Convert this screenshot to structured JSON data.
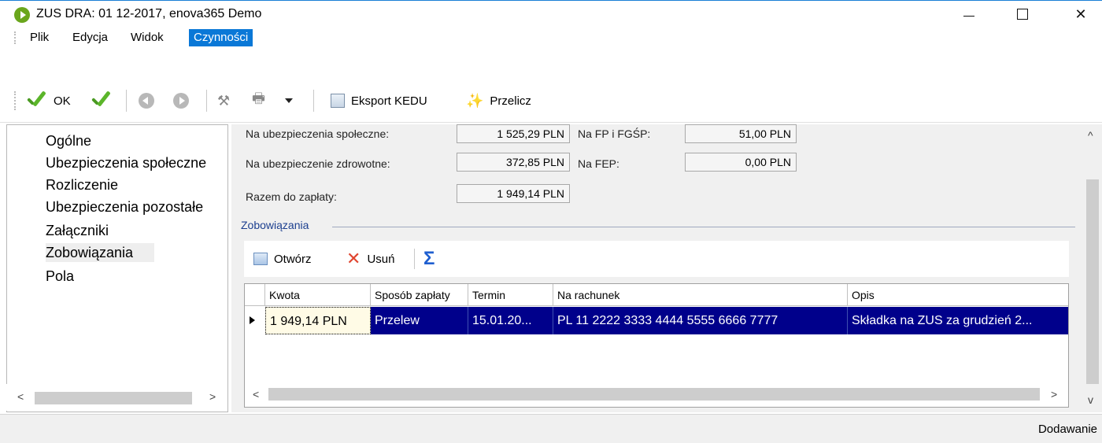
{
  "window": {
    "title": "ZUS DRA: 01 12-2017, enova365 Demo",
    "min_glyph": "",
    "close_glyph": "✕"
  },
  "menu": {
    "items": [
      "Plik",
      "Edycja",
      "Widok",
      "Czynności"
    ],
    "active": "Czynności"
  },
  "toolbar": {
    "ok_label": "OK",
    "export_label": "Eksport KEDU",
    "recalc_label": "Przelicz"
  },
  "nav": {
    "items": [
      "Ogólne",
      "Ubezpieczenia społeczne",
      "Rozliczenie",
      "Ubezpieczenia pozostałe",
      "Załączniki",
      "Zobowiązania",
      "Pola"
    ],
    "selected": "Zobowiązania"
  },
  "summary": {
    "social_label": "Na ubezpieczenia społeczne:",
    "social_value": "1 525,29 PLN",
    "health_label": "Na ubezpieczenie zdrowotne:",
    "health_value": "372,85 PLN",
    "total_label": "Razem do zapłaty:",
    "total_value": "1 949,14 PLN",
    "fp_label": "Na FP i FGŚP:",
    "fp_value": "51,00 PLN",
    "fep_label": "Na FEP:",
    "fep_value": "0,00 PLN"
  },
  "obligations": {
    "group_title": "Zobowiązania",
    "open_label": "Otwórz",
    "delete_label": "Usuń",
    "columns": [
      "Kwota",
      "Sposób zapłaty",
      "Termin",
      "Na rachunek",
      "Opis"
    ],
    "rows": [
      {
        "amount": "1 949,14 PLN",
        "method": "Przelew",
        "due": "15.01.20...",
        "account": "PL 11 2222 3333 4444 5555 6666 7777",
        "description": "Składka na ZUS za grudzień 2..."
      }
    ]
  },
  "status": {
    "mode": "Dodawanie"
  }
}
